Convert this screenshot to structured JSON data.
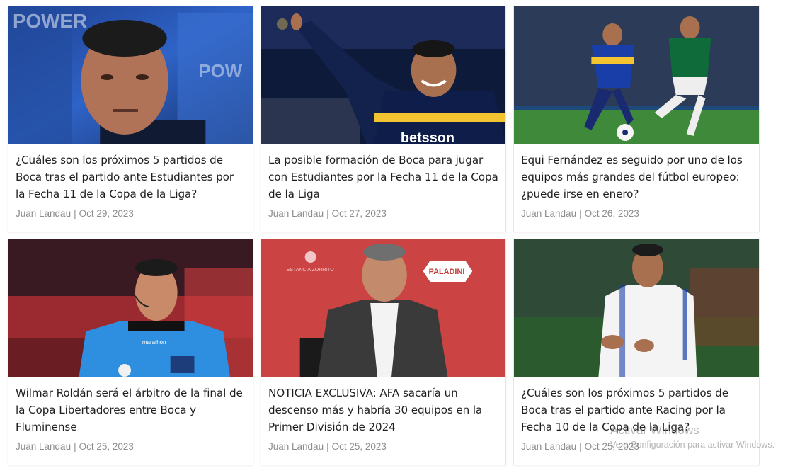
{
  "articles": [
    {
      "title": "¿Cuáles son los próximos 5 partidos de Boca tras el partido ante Estudiantes por la Fecha 11 de la Copa de la Liga?",
      "author": "Juan Landau",
      "date": "Oct 29, 2023",
      "image": "coach-closeup-photo"
    },
    {
      "title": "La posible formación de Boca para jugar con Estudiantes por la Fecha 11 de la Copa de la Liga",
      "author": "Juan Landau",
      "date": "Oct 27, 2023",
      "image": "boca-player-celebrating-photo"
    },
    {
      "title": "Equi Fernández es seguido por uno de los equipos más grandes del fútbol europeo: ¿puede irse en enero?",
      "author": "Juan Landau",
      "date": "Oct 26, 2023",
      "image": "match-action-photo"
    },
    {
      "title": "Wilmar Roldán será el árbitro de la final de la Copa Libertadores entre Boca y Fluminense",
      "author": "Juan Landau",
      "date": "Oct 25, 2023",
      "image": "referee-photo"
    },
    {
      "title": "NOTICIA EXCLUSIVA: AFA sacaría un descenso más y habría 30 equipos en la Primer División de 2024",
      "author": "Juan Landau",
      "date": "Oct 25, 2023",
      "image": "afa-president-photo"
    },
    {
      "title": "¿Cuáles son los próximos 5 partidos de Boca tras el partido ante Racing por la Fecha 10 de la Copa de la Liga?",
      "author": "Juan Landau",
      "date": "Oct 25, 2023",
      "image": "coach-gesturing-photo"
    }
  ],
  "separator": "|",
  "watermark": {
    "line1": "Activar Windows",
    "line2": "Ve a Configuración para activar Windows."
  },
  "colors": {
    "title": "#1f1f1f",
    "meta": "#8d8d8d",
    "card_border": "#e6e6e6"
  }
}
